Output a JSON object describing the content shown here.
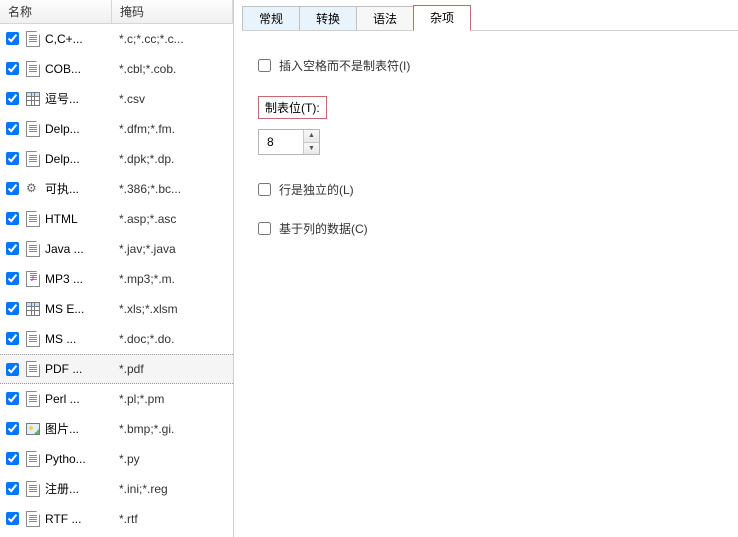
{
  "list": {
    "headers": {
      "name": "名称",
      "mask": "掩码"
    },
    "selected_index": 11,
    "rows": [
      {
        "name": "C,C+...",
        "mask": "*.c;*.cc;*.c...",
        "icon": "doc"
      },
      {
        "name": "COB...",
        "mask": "*.cbl;*.cob.",
        "icon": "doc"
      },
      {
        "name": "逗号...",
        "mask": "*.csv",
        "icon": "grid"
      },
      {
        "name": "Delp...",
        "mask": "*.dfm;*.fm.",
        "icon": "doc"
      },
      {
        "name": "Delp...",
        "mask": "*.dpk;*.dp.",
        "icon": "doc"
      },
      {
        "name": "可执...",
        "mask": "*.386;*.bc...",
        "icon": "gear"
      },
      {
        "name": "HTML",
        "mask": "*.asp;*.asc",
        "icon": "doc"
      },
      {
        "name": "Java ...",
        "mask": "*.jav;*.java",
        "icon": "doc"
      },
      {
        "name": "MP3 ...",
        "mask": "*.mp3;*.m.",
        "icon": "music"
      },
      {
        "name": "MS E...",
        "mask": "*.xls;*.xlsm",
        "icon": "grid"
      },
      {
        "name": "MS ...",
        "mask": "*.doc;*.do.",
        "icon": "doc"
      },
      {
        "name": "PDF ...",
        "mask": "*.pdf",
        "icon": "doc"
      },
      {
        "name": "Perl ...",
        "mask": "*.pl;*.pm",
        "icon": "doc"
      },
      {
        "name": "图片...",
        "mask": "*.bmp;*.gi.",
        "icon": "img"
      },
      {
        "name": "Pytho...",
        "mask": "*.py",
        "icon": "doc"
      },
      {
        "name": "注册...",
        "mask": "*.ini;*.reg",
        "icon": "doc"
      },
      {
        "name": "RTF ...",
        "mask": "*.rtf",
        "icon": "doc"
      }
    ]
  },
  "tabs": {
    "items": [
      {
        "label": "常规",
        "active": false
      },
      {
        "label": "转换",
        "active": false
      },
      {
        "label": "语法",
        "active": false
      },
      {
        "label": "杂项",
        "active": true
      }
    ]
  },
  "misc": {
    "insert_spaces_label": "插入空格而不是制表符(I)",
    "insert_spaces_checked": false,
    "tabstop_label": "制表位(T):",
    "tabstop_value": "8",
    "lines_independent_label": "行是独立的(L)",
    "lines_independent_checked": false,
    "column_based_label": "基于列的数据(C)",
    "column_based_checked": false
  }
}
